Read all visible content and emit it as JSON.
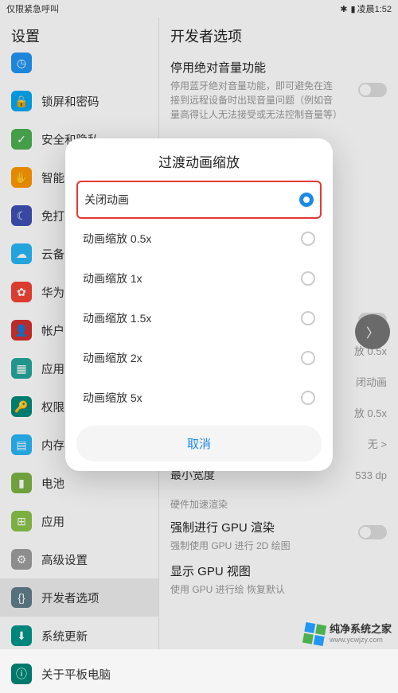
{
  "status": {
    "left": "仅限紧急呼叫",
    "bt": "✱",
    "batt_icon": "▮",
    "time": "凌晨1:52"
  },
  "left_pane": {
    "title": "设置",
    "items": [
      {
        "label": "锁屏和密码"
      },
      {
        "label": "安全和隐私"
      },
      {
        "label": "智能"
      },
      {
        "label": "免打"
      },
      {
        "label": "云备"
      },
      {
        "label": "华为"
      },
      {
        "label": "帐户"
      },
      {
        "label": "应用"
      },
      {
        "label": "权限"
      },
      {
        "label": "内存"
      },
      {
        "label": "电池"
      },
      {
        "label": "应用"
      },
      {
        "label": "高级设置"
      },
      {
        "label": "开发者选项"
      },
      {
        "label": "系统更新"
      },
      {
        "label": "关于平板电脑"
      }
    ]
  },
  "right_pane": {
    "title": "开发者选项",
    "section1_title": "停用绝对音量功能",
    "section1_desc": "停用蓝牙绝对音量功能，即可避免在连接到远程设备时出现音量问题（例如音量高得让人无法接受或无法控制音量等）",
    "rows_middle": [
      {
        "label": "放 0.5x"
      },
      {
        "label": "闭动画"
      },
      {
        "label": "放 0.5x"
      },
      {
        "label": "无 >"
      }
    ],
    "min_width_label": "最小宽度",
    "min_width_val": "533 dp",
    "hw_header": "硬件加速渲染",
    "gpu_title": "强制进行 GPU 渲染",
    "gpu_desc": "强制使用 GPU 进行 2D 绘图",
    "gpu2_title": "显示 GPU 视图",
    "gpu2_desc": "使用 GPU 进行绘 恢复默认"
  },
  "modal": {
    "title": "过渡动画缩放",
    "options": [
      {
        "label": "关闭动画",
        "selected": true,
        "highlight": true
      },
      {
        "label": "动画缩放 0.5x",
        "selected": false
      },
      {
        "label": "动画缩放 1x",
        "selected": false
      },
      {
        "label": "动画缩放 1.5x",
        "selected": false
      },
      {
        "label": "动画缩放 2x",
        "selected": false
      },
      {
        "label": "动画缩放 5x",
        "selected": false
      }
    ],
    "cancel": "取消"
  },
  "watermark": {
    "cn": "纯净系统之家",
    "en": "www.ycwjzy.com"
  }
}
